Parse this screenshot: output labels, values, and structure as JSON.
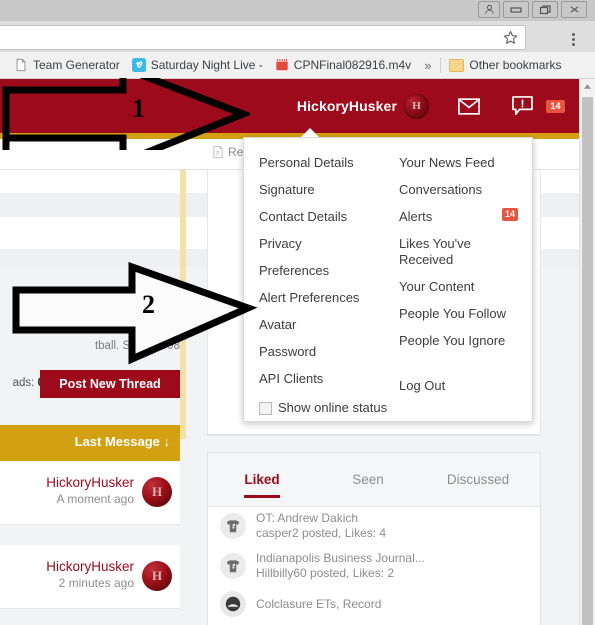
{
  "browser": {
    "window_controls": [
      "person-icon",
      "minimize-icon",
      "maximize-icon",
      "close-icon"
    ],
    "omnibox": {
      "value": "",
      "placeholder": ""
    },
    "star_icon": "star-icon",
    "menu_icon": "kebab-menu-icon",
    "bookmarks": [
      {
        "label": "Team Generator",
        "icon": "page-icon"
      },
      {
        "label": "Saturday Night Live -",
        "icon": "vimeo-icon"
      },
      {
        "label": "CPNFinal082916.m4v",
        "icon": "video-file-icon"
      }
    ],
    "overflow_label": "»",
    "other_bookmarks": {
      "label": "Other bookmarks",
      "icon": "folder-icon"
    }
  },
  "site_header": {
    "username": "HickoryHusker",
    "avatar_initial": "H",
    "inbox_icon": "envelope-icon",
    "alerts_icon": "alert-icon",
    "alert_count": "14",
    "background_color": "#9c0a1c",
    "stripe_color": "#d3a012"
  },
  "toolbar": {
    "item_label": "Re",
    "item_icon": "document-icon"
  },
  "dropdown": {
    "left_column": [
      {
        "label": "Personal Details"
      },
      {
        "label": "Signature"
      },
      {
        "label": "Contact Details"
      },
      {
        "label": "Privacy"
      },
      {
        "label": "Preferences"
      },
      {
        "label": "Alert Preferences"
      },
      {
        "label": "Avatar"
      },
      {
        "label": "Password"
      },
      {
        "label": "API Clients"
      }
    ],
    "right_column": [
      {
        "label": "Your News Feed",
        "badge": ""
      },
      {
        "label": "Conversations",
        "badge": ""
      },
      {
        "label": "Alerts",
        "badge": "14"
      },
      {
        "label": "Likes You've Received",
        "badge": ""
      },
      {
        "label": "Your Content",
        "badge": ""
      },
      {
        "label": "People You Follow",
        "badge": ""
      },
      {
        "label": "People You Ignore",
        "badge": ""
      }
    ],
    "show_online_status": "Show online status",
    "log_out": "Log Out",
    "badge_color": "#e8543f"
  },
  "sidebar": {
    "tagline": "tball. Since 1998",
    "threads_label": "ads:",
    "threads_count": "0",
    "post_button": "Post New Thread",
    "sort_label": "Last Message ↓",
    "threads": [
      {
        "user": "HickoryHusker",
        "time": "A moment ago",
        "avatar_initial": "H"
      },
      {
        "user": "HickoryHusker",
        "time": "2 minutes ago",
        "avatar_initial": "H"
      }
    ]
  },
  "tabs_card": {
    "tabs": [
      {
        "label": "Liked",
        "active": true
      },
      {
        "label": "Seen",
        "active": false
      },
      {
        "label": "Discussed",
        "active": false
      }
    ],
    "items": [
      {
        "title": "OT: Andrew Dakich",
        "sub": "casper2 posted, Likes: 4"
      },
      {
        "title": "Indianapolis Business Journal...",
        "sub": "Hillbilly60 posted, Likes: 2"
      },
      {
        "title": "Colclasure ETs, Record",
        "sub": ""
      }
    ]
  },
  "annotations": [
    {
      "number": "1"
    },
    {
      "number": "2"
    }
  ]
}
